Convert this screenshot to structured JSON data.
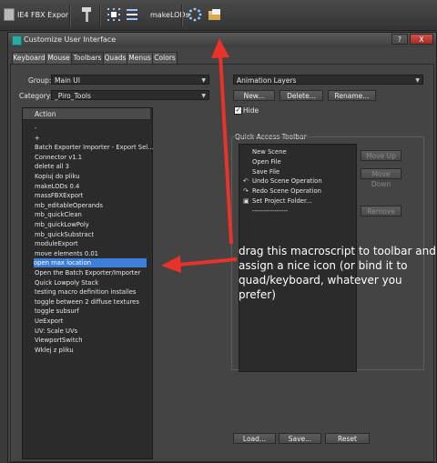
{
  "toolbar": {
    "export_label": "IE4 FBX Expor",
    "makelods_label": "makeLODs"
  },
  "dialog": {
    "title": "Customize User Interface",
    "tabs": [
      "Keyboard",
      "Mouse",
      "Toolbars",
      "Quads",
      "Menus",
      "Colors"
    ],
    "active_tab": "Toolbars",
    "help_label": "?",
    "close_label": "X",
    "group_label": "Group:",
    "group_value": "Main UI",
    "category_label": "Category:",
    "category_value": "_Piro_Tools",
    "toolbar_select_value": "Animation Layers",
    "new_button": "New...",
    "delete_button": "Delete...",
    "rename_button": "Rename...",
    "hide_label": "Hide",
    "hide_checked": true,
    "action_header": "Action",
    "actions": [
      "-",
      "+",
      "Batch Exporter Importer - Export Sel...",
      "Connector v1.1",
      "delete all 3",
      "Kopiuj do pliku",
      "makeLODs 0.4",
      "massFBXExport",
      "mb_editableOperands",
      "mb_quickClean",
      "mb_quickLowPoly",
      "mb_quickSubstract",
      "moduleExport",
      "move elements 0.01",
      "open max location",
      "Open the Batch Exporter/Importer",
      "Quick Lowpoly Stack",
      "testing macro definition installes",
      "toggle between 2 diffuse textures",
      "toggle subsurf",
      "UeExport",
      "UV: Scale UVs",
      "ViewportSwitch",
      "Wklej z pliku"
    ],
    "selected_action": "open max location",
    "qat_label": "Quick Access Toolbar",
    "qat_items": [
      {
        "label": "New Scene",
        "icon": ""
      },
      {
        "label": "Open File",
        "icon": ""
      },
      {
        "label": "Save File",
        "icon": ""
      },
      {
        "label": "Undo Scene Operation",
        "icon": "undo-icon"
      },
      {
        "label": "Redo Scene Operation",
        "icon": "redo-icon"
      },
      {
        "label": "Set Project Folder...",
        "icon": "folder-icon"
      },
      {
        "label": "----------------",
        "icon": ""
      }
    ],
    "move_up_button": "Move Up",
    "move_down_button": "Move Down",
    "remove_button": "Remove",
    "load_button": "Load...",
    "save_button": "Save...",
    "reset_button": "Reset"
  },
  "annotation": {
    "text": "drag this macroscript to toolbar and assign a nice icon (or bind it to quad/keyboard, whatever you prefer)"
  },
  "colors": {
    "arrow": "#e8322c",
    "selection": "#3d7fd8"
  }
}
